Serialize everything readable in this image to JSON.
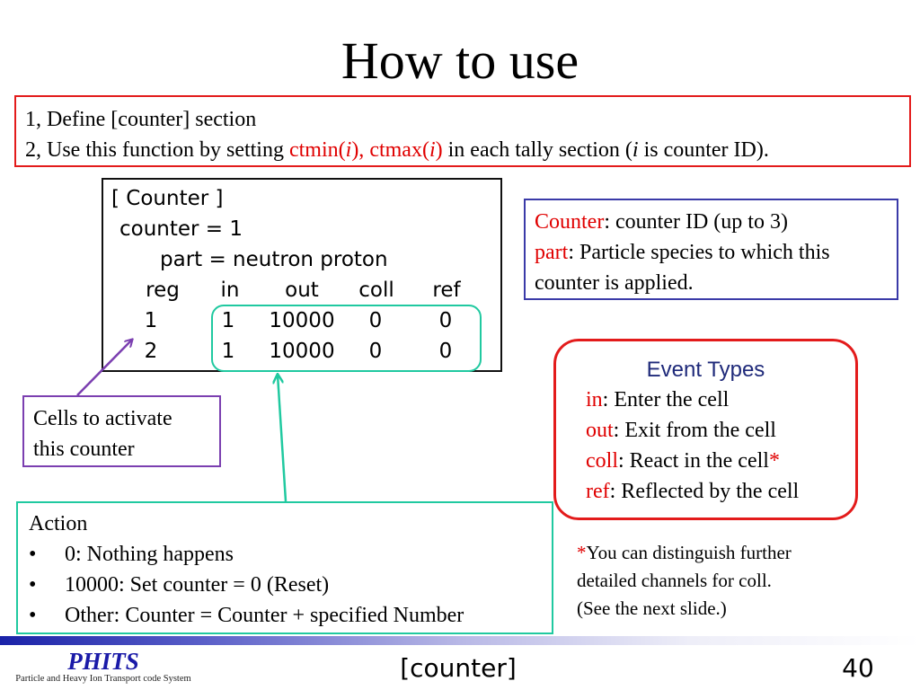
{
  "slide": {
    "title": "How to use",
    "page_number": "40",
    "footer_title": "[counter]"
  },
  "steps": {
    "line1": "1, Define [counter] section",
    "line2_prefix": "2, Use this function by setting ",
    "line2_ctmin": "ctmin(",
    "line2_i1": "i",
    "line2_ctmin_close": "),",
    "line2_space": " ",
    "line2_ctmax": "ctmax(",
    "line2_i2": "i",
    "line2_ctmax_close": ")",
    "line2_mid": " in each tally section (",
    "line2_i3": "i",
    "line2_suffix": " is counter ID)."
  },
  "code": {
    "section": "[ Counter ]",
    "counter_line": "counter = 1",
    "part_line": "part = neutron proton",
    "headers": [
      "reg",
      "in",
      "out",
      "coll",
      "ref"
    ],
    "rows": [
      [
        "1",
        "1",
        "10000",
        "0",
        "0"
      ],
      [
        "2",
        "1",
        "10000",
        "0",
        "0"
      ]
    ]
  },
  "id_box": {
    "counter_key": "Counter",
    "counter_desc": ": counter ID (up to 3)",
    "part_key": "part",
    "part_desc": ": Particle species to which this",
    "part_desc2": "counter is applied."
  },
  "event_types": {
    "heading": "Event Types",
    "items": [
      {
        "key": "in",
        "desc": ": Enter the cell",
        "star": ""
      },
      {
        "key": "out",
        "desc": ": Exit from the cell",
        "star": ""
      },
      {
        "key": "coll",
        "desc": ": React in the cell",
        "star": "*"
      },
      {
        "key": "ref",
        "desc": ": Reflected by the cell",
        "star": ""
      }
    ]
  },
  "note": {
    "star": "*",
    "line1": "You can distinguish further",
    "line2": "detailed channels for coll.",
    "line3": "(See the next slide.)"
  },
  "cells_box": {
    "line1": "Cells to activate",
    "line2": "this counter"
  },
  "action": {
    "heading": "Action",
    "bullet": "•",
    "items": [
      "0: Nothing happens",
      "10000: Set counter = 0  (Reset)",
      "Other: Counter = Counter + specified Number"
    ]
  },
  "logo": {
    "brand": "PHITS",
    "subtitle": "Particle and Heavy Ion Transport code System"
  },
  "colors": {
    "accent_red": "#e00000",
    "box_blue": "#3a3aa8",
    "box_teal": "#20c9a0",
    "box_purple": "#7b3fb0",
    "heading_navy": "#1f2a7a"
  }
}
